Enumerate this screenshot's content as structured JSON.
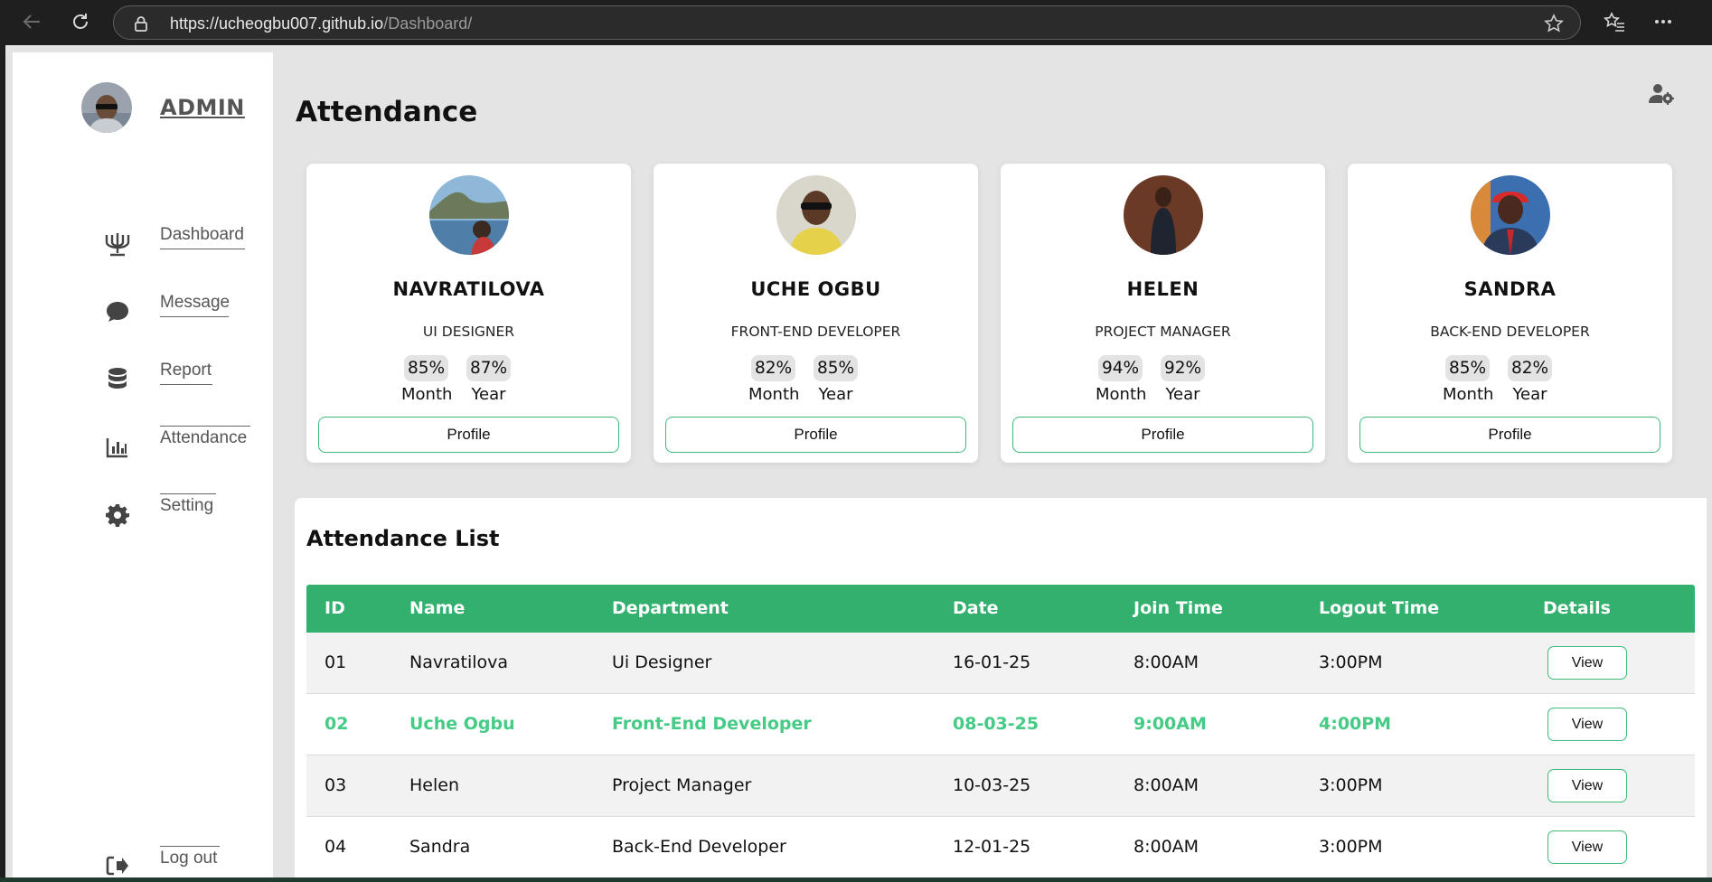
{
  "browser": {
    "url_host": "https://ucheogbu007.github.io",
    "url_path": "/Dashboard/",
    "icons": [
      "back-arrow-icon",
      "reload-icon",
      "lock-icon",
      "star-icon",
      "favorites-icon",
      "more-icon"
    ]
  },
  "sidebar": {
    "title": "ADMIN",
    "items": [
      {
        "label": "Dashboard",
        "icon": "menorah-icon"
      },
      {
        "label": "Message",
        "icon": "chat-bubble-icon"
      },
      {
        "label": "Report",
        "icon": "database-icon"
      },
      {
        "label": "Attendance",
        "icon": "bar-chart-icon"
      },
      {
        "label": "Setting",
        "icon": "gear-icon"
      }
    ],
    "logout": {
      "label": "Log out",
      "icon": "logout-icon"
    }
  },
  "main": {
    "title": "Attendance",
    "header_icon": "user-gear-icon"
  },
  "cards": [
    {
      "name": "NAVRATILOVA",
      "role": "UI DESIGNER",
      "month_pct": "85%",
      "year_pct": "87%",
      "month_label": "Month",
      "year_label": "Year",
      "button": "Profile"
    },
    {
      "name": "UCHE OGBU",
      "role": "FRONT-END DEVELOPER",
      "month_pct": "82%",
      "year_pct": "85%",
      "month_label": "Month",
      "year_label": "Year",
      "button": "Profile"
    },
    {
      "name": "HELEN",
      "role": "PROJECT MANAGER",
      "month_pct": "94%",
      "year_pct": "92%",
      "month_label": "Month",
      "year_label": "Year",
      "button": "Profile"
    },
    {
      "name": "SANDRA",
      "role": "BACK-END DEVELOPER",
      "month_pct": "85%",
      "year_pct": "82%",
      "month_label": "Month",
      "year_label": "Year",
      "button": "Profile"
    }
  ],
  "attendance_list": {
    "title": "Attendance List",
    "columns": [
      "ID",
      "Name",
      "Department",
      "Date",
      "Join Time",
      "Logout Time",
      "Details"
    ],
    "rows": [
      {
        "id": "01",
        "name": "Navratilova",
        "department": "Ui Designer",
        "date": "16-01-25",
        "join": "8:00AM",
        "logout": "3:00PM",
        "action": "View"
      },
      {
        "id": "02",
        "name": "Uche Ogbu",
        "department": "Front-End Developer",
        "date": "08-03-25",
        "join": "9:00AM",
        "logout": "4:00PM",
        "action": "View"
      },
      {
        "id": "03",
        "name": "Helen",
        "department": "Project Manager",
        "date": "10-03-25",
        "join": "8:00AM",
        "logout": "3:00PM",
        "action": "View"
      },
      {
        "id": "04",
        "name": "Sandra",
        "department": "Back-End Developer",
        "date": "12-01-25",
        "join": "8:00AM",
        "logout": "3:00PM",
        "action": "View"
      }
    ]
  },
  "colors": {
    "accent_green": "#33b06d",
    "highlight_green": "#45cb85",
    "page_bg": "#e4e4e4"
  }
}
